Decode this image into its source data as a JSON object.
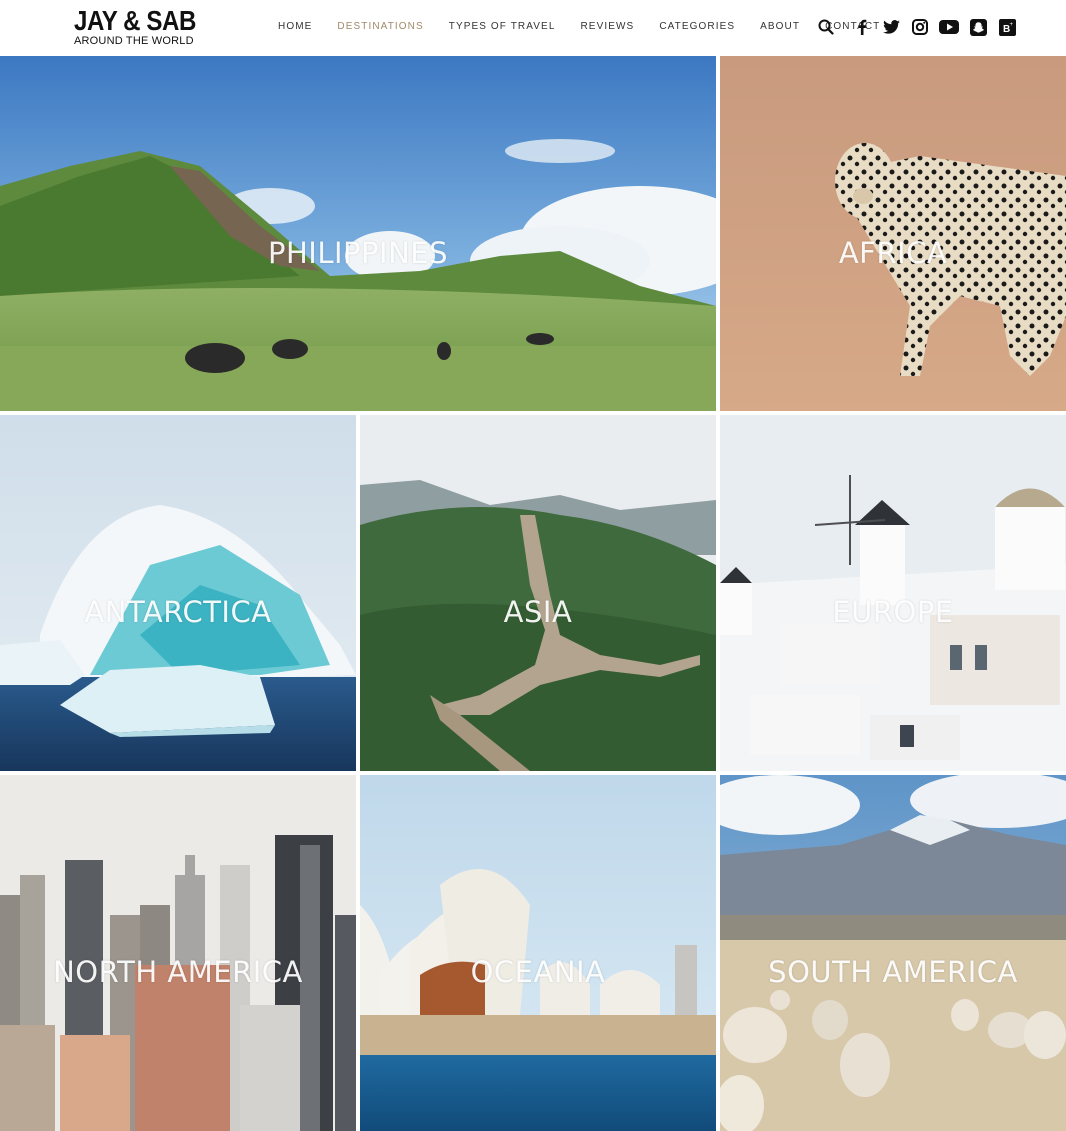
{
  "brand": {
    "title": "JAY & SAB",
    "subtitle": "AROUND THE WORLD"
  },
  "nav": {
    "home": "HOME",
    "destinations": "DESTINATIONS",
    "types_of_travel": "TYPES OF TRAVEL",
    "reviews": "REVIEWS",
    "categories": "CATEGORIES",
    "about": "ABOUT",
    "contact": "CONTACT"
  },
  "icons": [
    "search-icon",
    "facebook-icon",
    "twitter-icon",
    "instagram-icon",
    "youtube-icon",
    "snapchat-icon",
    "bloglovin-icon"
  ],
  "colors": {
    "nav_active": "#a08a6a",
    "text": "#333333"
  },
  "destinations": {
    "philippines": "PHILIPPINES",
    "africa": "AFRICA",
    "antarctica": "ANTARCTICA",
    "asia": "ASIA",
    "europe": "EUROPE",
    "north_america": "NORTH AMERICA",
    "oceania": "OCEANIA",
    "south_america": "SOUTH AMERICA"
  }
}
